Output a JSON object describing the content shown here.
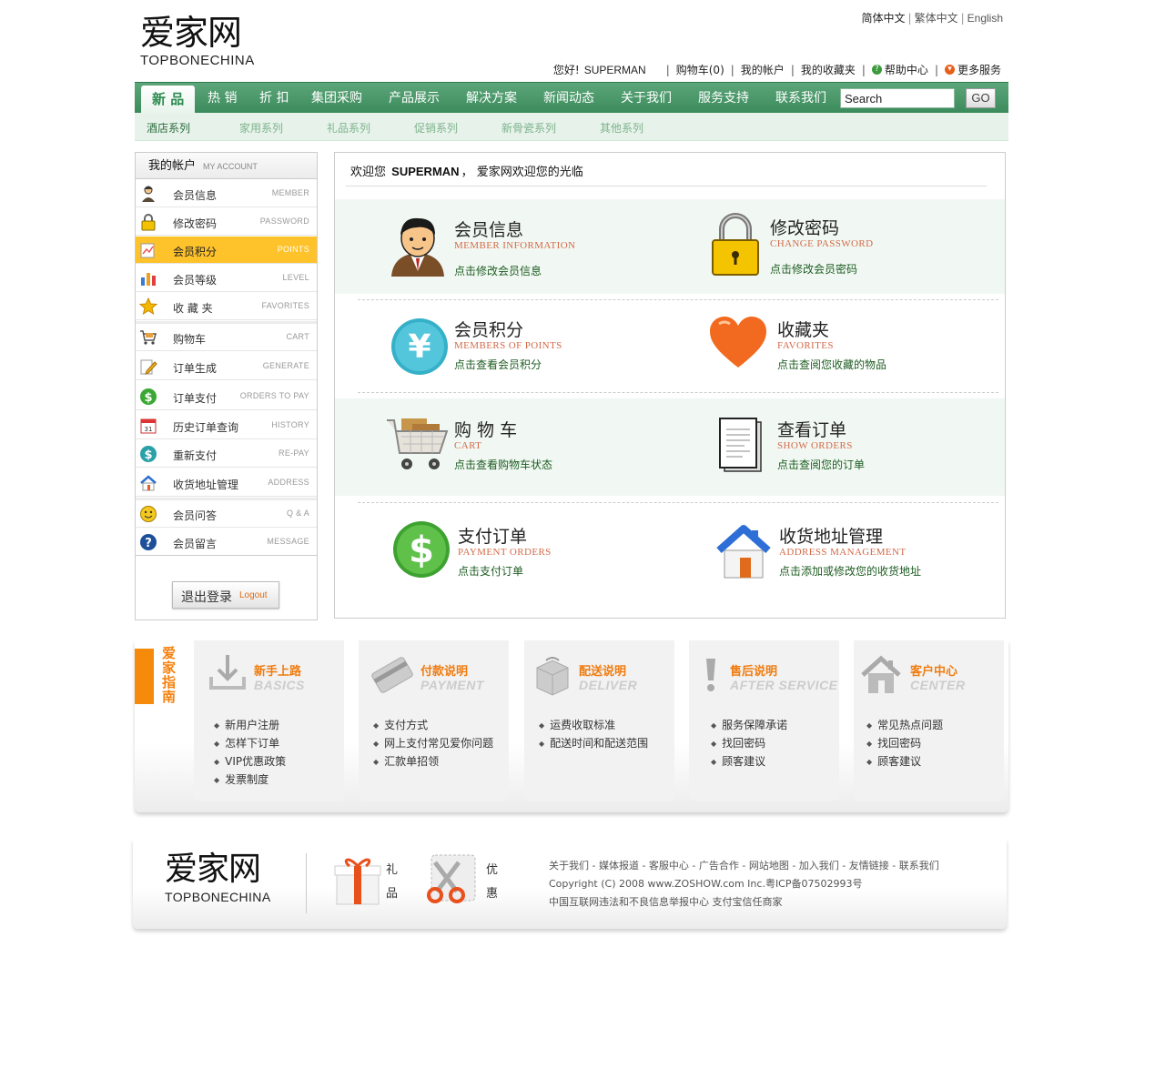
{
  "header": {
    "logo_cn": "爱家网",
    "logo_en": "TOPBONECHINA",
    "lang_simplified": "简体中文",
    "lang_traditional": "繁体中文",
    "lang_english": "English",
    "greeting": "您好!",
    "username": "SUPERMAN",
    "cart": "购物车(0)",
    "my_account": "我的帐户",
    "my_favorites": "我的收藏夹",
    "help": "帮助中心",
    "more": "更多服务"
  },
  "nav": {
    "items": [
      "新 品",
      "热 销",
      "折 扣",
      "集团采购",
      "产品展示",
      "解决方案",
      "新闻动态",
      "关于我们",
      "服务支持",
      "联系我们"
    ],
    "search_placeholder": "Search",
    "go": "GO"
  },
  "subnav": [
    "酒店系列",
    "家用系列",
    "礼品系列",
    "促销系列",
    "新骨瓷系列",
    "其他系列"
  ],
  "sidebar": {
    "title": "我的帐户",
    "title_en": "MY ACCOUNT",
    "items": [
      {
        "label": "会员信息",
        "en": "MEMBER"
      },
      {
        "label": "修改密码",
        "en": "PASSWORD"
      },
      {
        "label": "会员积分",
        "en": "POINTS"
      },
      {
        "label": "会员等级",
        "en": "LEVEL"
      },
      {
        "label": "收 藏 夹",
        "en": "FAVORITES"
      },
      {
        "label": "购物车",
        "en": "CART"
      },
      {
        "label": "订单生成",
        "en": "GENERATE"
      },
      {
        "label": "订单支付",
        "en": "ORDERS TO PAY"
      },
      {
        "label": "历史订单查询",
        "en": "HISTORY"
      },
      {
        "label": "重新支付",
        "en": "RE-PAY"
      },
      {
        "label": "收货地址管理",
        "en": "ADDRESS"
      },
      {
        "label": "会员问答",
        "en": "Q & A"
      },
      {
        "label": "会员留言",
        "en": "MESSAGE"
      }
    ],
    "logout_cn": "退出登录",
    "logout_en": "Logout"
  },
  "main": {
    "welcome_pre": "欢迎您",
    "welcome_user": "SUPERMAN",
    "welcome_post": "， 爱家网欢迎您的光临",
    "cards": [
      {
        "title": "会员信息",
        "en": "MEMBER INFORMATION",
        "link": "点击修改会员信息"
      },
      {
        "title": "修改密码",
        "en": "CHANGE PASSWORD",
        "link": "点击修改会员密码"
      },
      {
        "title": "会员积分",
        "en": "MEMBERS OF POINTS",
        "link": "点击查看会员积分"
      },
      {
        "title": "收藏夹",
        "en": "FAVORITES",
        "link": "点击查阅您收藏的物品"
      },
      {
        "title": "购 物 车",
        "en": "CART",
        "link": "点击查看购物车状态"
      },
      {
        "title": "查看订单",
        "en": "SHOW ORDERS",
        "link": "点击查阅您的订单"
      },
      {
        "title": "支付订单",
        "en": "PAYMENT ORDERS",
        "link": "点击支付订单"
      },
      {
        "title": "收货地址管理",
        "en": "ADDRESS MANAGEMENT",
        "link": "点击添加或修改您的收货地址"
      }
    ]
  },
  "guide": {
    "label": "爱家指南",
    "boxes": [
      {
        "title": "新手上路",
        "en": "BASICS",
        "items": [
          "新用户注册",
          "怎样下订单",
          "VIP优惠政策",
          "发票制度"
        ]
      },
      {
        "title": "付款说明",
        "en": "PAYMENT",
        "items": [
          "支付方式",
          "网上支付常见爱你问题",
          "汇款单招领"
        ]
      },
      {
        "title": "配送说明",
        "en": "DELIVER",
        "items": [
          "运费收取标准",
          "配送时间和配送范围"
        ]
      },
      {
        "title": "售后说明",
        "en": "AFTER SERVICE",
        "items": [
          "服务保障承诺",
          "找回密码",
          "顾客建议"
        ]
      },
      {
        "title": "客户中心",
        "en": "CENTER",
        "items": [
          "常见热点问题",
          "找回密码",
          "顾客建议"
        ]
      }
    ]
  },
  "footer": {
    "logo_cn": "爱家网",
    "logo_en": "TOPBONECHINA",
    "gift": "礼品",
    "discount": "优惠",
    "links": "关于我们 - 媒体报道 - 客服中心 - 广告合作 - 网站地图 - 加入我们 - 友情链接 - 联系我们",
    "copyright": "Copyright (C) 2008 www.ZOSHOW.com Inc.粤ICP备07502993号",
    "notice": "中国互联网违法和不良信息举报中心 支付宝信任商家"
  },
  "colors": {
    "nav_green": "#3c8b5c",
    "highlight": "#fec22a",
    "accent_orange": "#f07c10",
    "english_red": "#d36b4a"
  }
}
